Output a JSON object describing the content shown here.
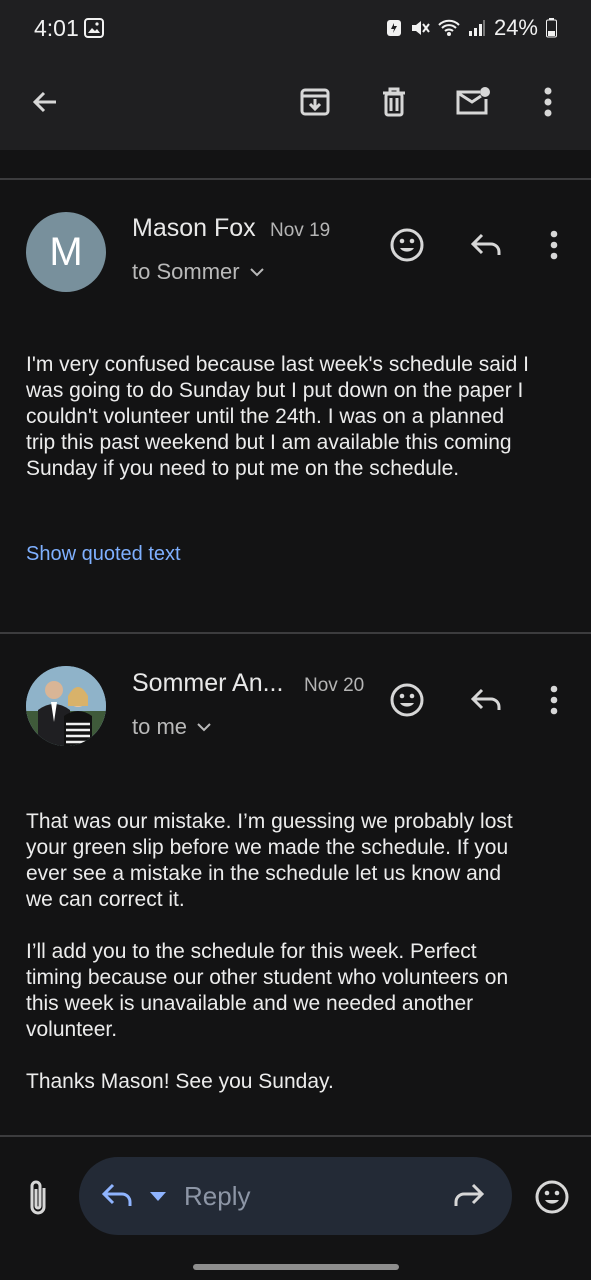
{
  "status_bar": {
    "time": "4:01",
    "battery": "24%"
  },
  "toolbar": {
    "back_icon": "arrow-back-icon",
    "archive_icon": "archive-icon",
    "delete_icon": "trash-icon",
    "mark_unread_icon": "mail-unread-icon",
    "more_icon": "more-vert-icon"
  },
  "messages": [
    {
      "avatar_letter": "M",
      "avatar_color": "#78909c",
      "sender": "Mason Fox",
      "date": "Nov 19",
      "recipient": "to Sommer",
      "body": "I'm very confused because last week's schedule said I\nwas going to do Sunday but I put down on the paper I\ncouldn't volunteer until the 24th. I was on a planned\ntrip this past weekend but I am available this coming\nSunday if you need to put me on the schedule.",
      "quoted_link": "Show quoted text"
    },
    {
      "sender": "Sommer An...",
      "date": "Nov 20",
      "recipient": "to me",
      "body": "That was our mistake. I’m guessing we probably lost\nyour green slip before we made the schedule. If you\never see a mistake in the schedule let us know and\nwe can correct it.\n\nI’ll add you to the schedule for this week. Perfect\ntiming because our other student who volunteers on\nthis week is unavailable and we needed another\nvolunteer.\n\nThanks Mason! See you Sunday."
    }
  ],
  "compose_bar": {
    "reply_label": "Reply"
  },
  "colors": {
    "background": "#131314",
    "link": "#7fb0ff",
    "reply_bar": "#232a36"
  }
}
